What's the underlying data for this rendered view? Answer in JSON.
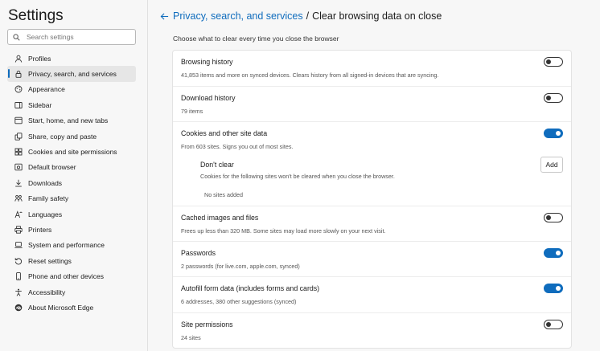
{
  "sidebar": {
    "title": "Settings",
    "search_placeholder": "Search settings",
    "items": [
      {
        "label": "Profiles",
        "icon": "profile-icon"
      },
      {
        "label": "Privacy, search, and services",
        "icon": "lock-icon"
      },
      {
        "label": "Appearance",
        "icon": "appearance-icon"
      },
      {
        "label": "Sidebar",
        "icon": "sidebar-icon"
      },
      {
        "label": "Start, home, and new tabs",
        "icon": "home-icon"
      },
      {
        "label": "Share, copy and paste",
        "icon": "share-icon"
      },
      {
        "label": "Cookies and site permissions",
        "icon": "permissions-icon"
      },
      {
        "label": "Default browser",
        "icon": "browser-icon"
      },
      {
        "label": "Downloads",
        "icon": "download-icon"
      },
      {
        "label": "Family safety",
        "icon": "family-icon"
      },
      {
        "label": "Languages",
        "icon": "language-icon"
      },
      {
        "label": "Printers",
        "icon": "printer-icon"
      },
      {
        "label": "System and performance",
        "icon": "laptop-icon"
      },
      {
        "label": "Reset settings",
        "icon": "reset-icon"
      },
      {
        "label": "Phone and other devices",
        "icon": "phone-icon"
      },
      {
        "label": "Accessibility",
        "icon": "accessibility-icon"
      },
      {
        "label": "About Microsoft Edge",
        "icon": "edge-icon"
      }
    ],
    "active_index": 1
  },
  "header": {
    "parent": "Privacy, search, and services",
    "separator": "/",
    "current": "Clear browsing data on close"
  },
  "subtitle": "Choose what to clear every time you close the browser",
  "rows": [
    {
      "title": "Browsing history",
      "desc": "41,853 items and more on synced devices. Clears history from all signed-in devices that are syncing.",
      "on": false
    },
    {
      "title": "Download history",
      "desc": "79 items",
      "on": false
    },
    {
      "title": "Cookies and other site data",
      "desc": "From 603 sites. Signs you out of most sites.",
      "on": true
    },
    {
      "title": "Cached images and files",
      "desc": "Frees up less than 320 MB. Some sites may load more slowly on your next visit.",
      "on": false
    },
    {
      "title": "Passwords",
      "desc": "2 passwords (for live.com, apple.com, synced)",
      "on": true
    },
    {
      "title": "Autofill form data (includes forms and cards)",
      "desc": "6 addresses, 380 other suggestions (synced)",
      "on": true
    },
    {
      "title": "Site permissions",
      "desc": "24 sites",
      "on": false
    }
  ],
  "dont_clear": {
    "title": "Don't clear",
    "desc": "Cookies for the following sites won't be cleared when you close the browser.",
    "add_label": "Add",
    "empty": "No sites added"
  },
  "colors": {
    "accent": "#0f6cbd"
  }
}
